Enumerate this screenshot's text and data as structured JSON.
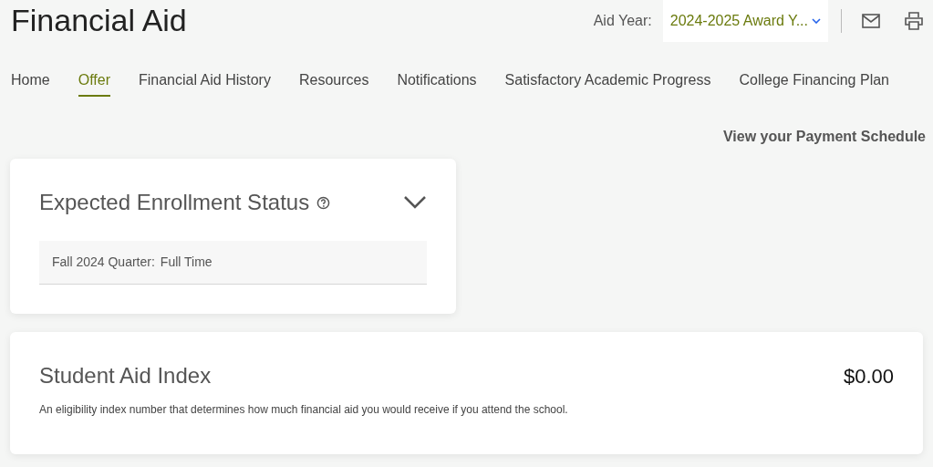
{
  "header": {
    "title": "Financial Aid",
    "aid_year_label": "Aid Year:",
    "aid_year_value": "2024-2025 Award Y..."
  },
  "tabs": [
    {
      "label": "Home",
      "selected": false
    },
    {
      "label": "Offer",
      "selected": true
    },
    {
      "label": "Financial Aid History",
      "selected": false
    },
    {
      "label": "Resources",
      "selected": false
    },
    {
      "label": "Notifications",
      "selected": false
    },
    {
      "label": "Satisfactory Academic Progress",
      "selected": false
    },
    {
      "label": "College Financing Plan",
      "selected": false
    }
  ],
  "payment_link": "View your Payment Schedule",
  "enrollment_card": {
    "title": "Expected Enrollment Status",
    "expanded": true,
    "rows": [
      {
        "term": "Fall 2024 Quarter:",
        "status": "Full Time"
      }
    ]
  },
  "aid_index_card": {
    "title": "Student Aid Index",
    "amount": "$0.00",
    "description": "An eligibility index number that determines how much financial aid you would receive if you attend the school."
  }
}
